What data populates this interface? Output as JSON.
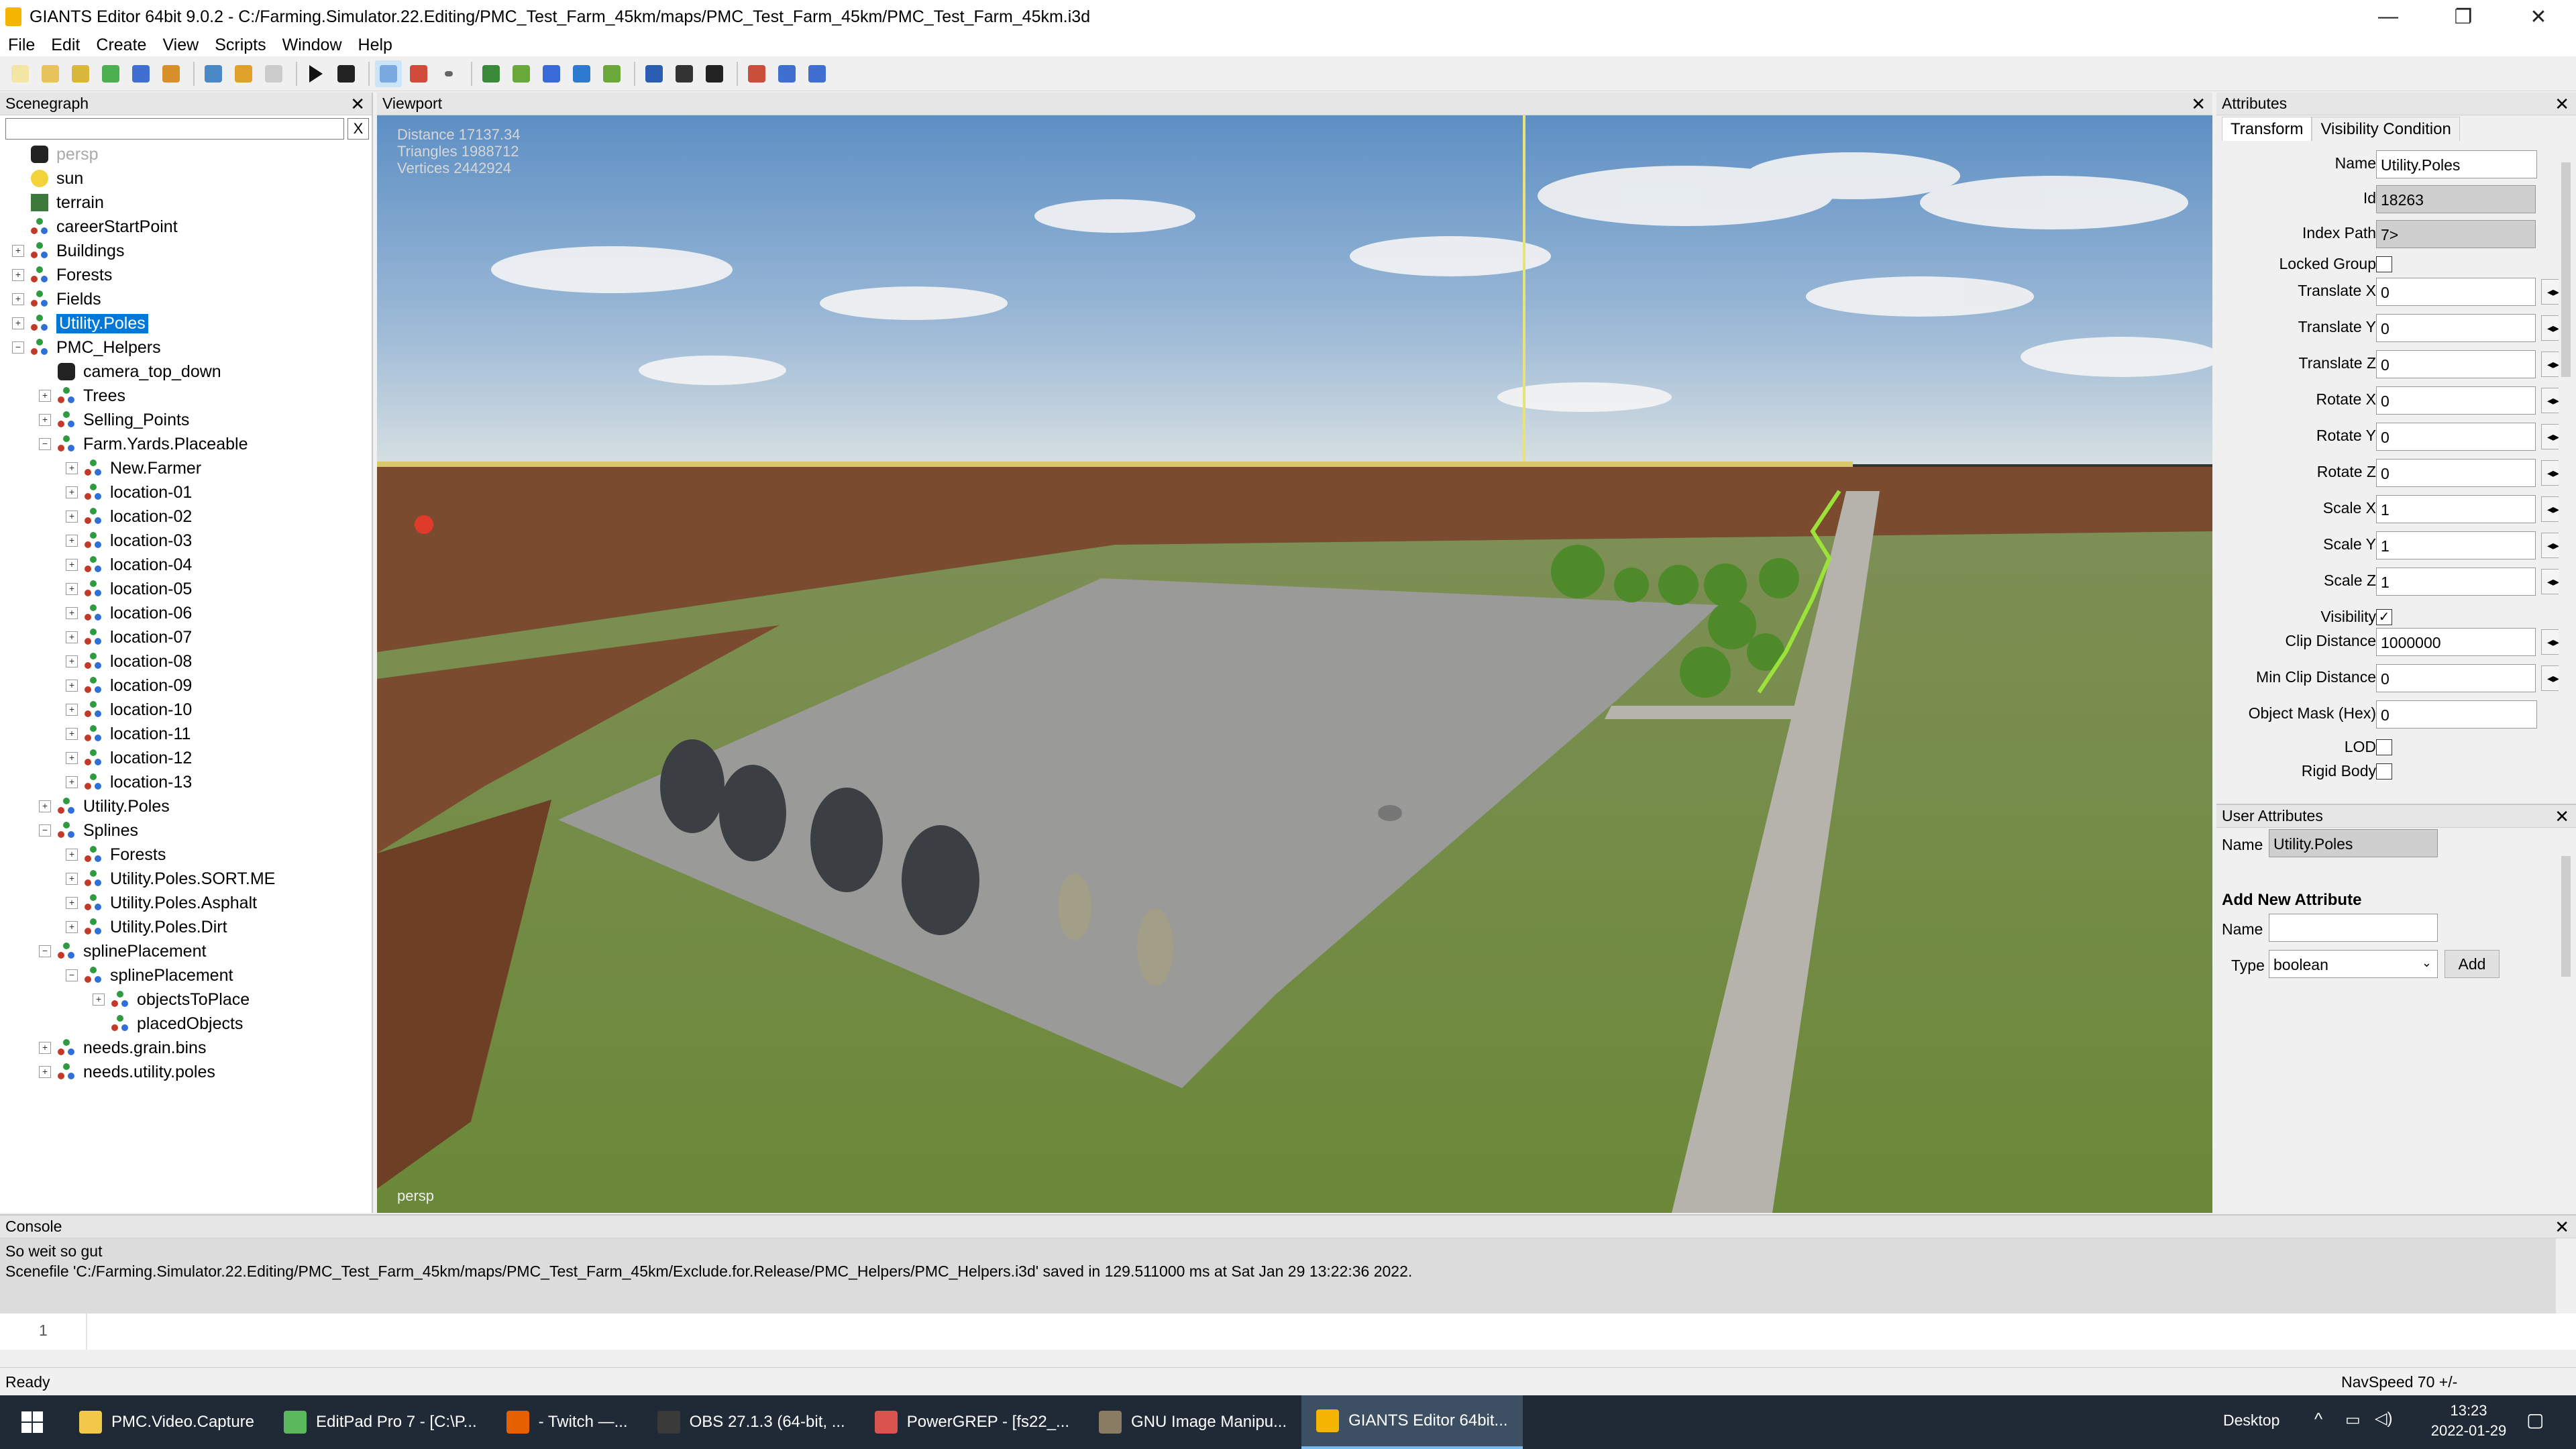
{
  "window": {
    "title": "GIANTS Editor 64bit 9.0.2 - C:/Farming.Simulator.22.Editing/PMC_Test_Farm_45km/maps/PMC_Test_Farm_45km/PMC_Test_Farm_45km.i3d",
    "minimize": "—",
    "maximize": "❐",
    "close": "✕"
  },
  "menu": [
    "File",
    "Edit",
    "Create",
    "View",
    "Scripts",
    "Window",
    "Help"
  ],
  "toolbar_icons": [
    "new-file-icon",
    "open-file-icon",
    "edit-icon",
    "refresh-icon",
    "save-icon",
    "export-icon",
    "history-icon",
    "undo-icon",
    "redo-icon",
    "play-icon",
    "eye-icon",
    "select-icon",
    "paint-icon",
    "dropdown-icon",
    "terrain-icon",
    "foliage-icon",
    "brush-icon",
    "decal-icon",
    "tree-icon",
    "move-icon",
    "rotate-icon",
    "scale-icon",
    "render-icon",
    "settings-icon",
    "tools-icon"
  ],
  "scenegraph": {
    "title": "Scenegraph",
    "close": "✕",
    "search_clear": "X",
    "nodes": [
      {
        "label": "persp",
        "depth": 0,
        "exp": "",
        "icon": "camera",
        "dim": true
      },
      {
        "label": "sun",
        "depth": 0,
        "exp": "",
        "icon": "light"
      },
      {
        "label": "terrain",
        "depth": 0,
        "exp": "",
        "icon": "terrain"
      },
      {
        "label": "careerStartPoint",
        "depth": 0,
        "exp": "",
        "icon": "tg"
      },
      {
        "label": "Buildings",
        "depth": 0,
        "exp": "+",
        "icon": "tg"
      },
      {
        "label": "Forests",
        "depth": 0,
        "exp": "+",
        "icon": "tg"
      },
      {
        "label": "Fields",
        "depth": 0,
        "exp": "+",
        "icon": "tg"
      },
      {
        "label": "Utility.Poles",
        "depth": 0,
        "exp": "+",
        "icon": "tg",
        "selected": true
      },
      {
        "label": "PMC_Helpers",
        "depth": 0,
        "exp": "−",
        "icon": "tg"
      },
      {
        "label": "camera_top_down",
        "depth": 1,
        "exp": "",
        "icon": "camera"
      },
      {
        "label": "Trees",
        "depth": 1,
        "exp": "+",
        "icon": "tg"
      },
      {
        "label": "Selling_Points",
        "depth": 1,
        "exp": "+",
        "icon": "tg"
      },
      {
        "label": "Farm.Yards.Placeable",
        "depth": 1,
        "exp": "−",
        "icon": "tg"
      },
      {
        "label": "New.Farmer",
        "depth": 2,
        "exp": "+",
        "icon": "tg"
      },
      {
        "label": "location-01",
        "depth": 2,
        "exp": "+",
        "icon": "tg"
      },
      {
        "label": "location-02",
        "depth": 2,
        "exp": "+",
        "icon": "tg"
      },
      {
        "label": "location-03",
        "depth": 2,
        "exp": "+",
        "icon": "tg"
      },
      {
        "label": "location-04",
        "depth": 2,
        "exp": "+",
        "icon": "tg"
      },
      {
        "label": "location-05",
        "depth": 2,
        "exp": "+",
        "icon": "tg"
      },
      {
        "label": "location-06",
        "depth": 2,
        "exp": "+",
        "icon": "tg"
      },
      {
        "label": "location-07",
        "depth": 2,
        "exp": "+",
        "icon": "tg"
      },
      {
        "label": "location-08",
        "depth": 2,
        "exp": "+",
        "icon": "tg"
      },
      {
        "label": "location-09",
        "depth": 2,
        "exp": "+",
        "icon": "tg"
      },
      {
        "label": "location-10",
        "depth": 2,
        "exp": "+",
        "icon": "tg"
      },
      {
        "label": "location-11",
        "depth": 2,
        "exp": "+",
        "icon": "tg"
      },
      {
        "label": "location-12",
        "depth": 2,
        "exp": "+",
        "icon": "tg"
      },
      {
        "label": "location-13",
        "depth": 2,
        "exp": "+",
        "icon": "tg"
      },
      {
        "label": "Utility.Poles",
        "depth": 1,
        "exp": "+",
        "icon": "tg"
      },
      {
        "label": "Splines",
        "depth": 1,
        "exp": "−",
        "icon": "tg"
      },
      {
        "label": "Forests",
        "depth": 2,
        "exp": "+",
        "icon": "tg"
      },
      {
        "label": "Utility.Poles.SORT.ME",
        "depth": 2,
        "exp": "+",
        "icon": "tg"
      },
      {
        "label": "Utility.Poles.Asphalt",
        "depth": 2,
        "exp": "+",
        "icon": "tg"
      },
      {
        "label": "Utility.Poles.Dirt",
        "depth": 2,
        "exp": "+",
        "icon": "tg"
      },
      {
        "label": "splinePlacement",
        "depth": 1,
        "exp": "−",
        "icon": "tg"
      },
      {
        "label": "splinePlacement",
        "depth": 2,
        "exp": "−",
        "icon": "tg"
      },
      {
        "label": "objectsToPlace",
        "depth": 3,
        "exp": "+",
        "icon": "tg"
      },
      {
        "label": "placedObjects",
        "depth": 3,
        "exp": "",
        "icon": "tg"
      },
      {
        "label": "needs.grain.bins",
        "depth": 1,
        "exp": "+",
        "icon": "tg"
      },
      {
        "label": "needs.utility.poles",
        "depth": 1,
        "exp": "+",
        "icon": "tg"
      }
    ]
  },
  "viewport": {
    "title": "Viewport",
    "close": "✕",
    "stats": [
      "Distance 17137.34",
      "Triangles 1988712",
      "Vertices 2442924"
    ],
    "camera": "persp"
  },
  "attributes": {
    "title": "Attributes",
    "close": "✕",
    "tabs": [
      "Transform",
      "Visibility Condition"
    ],
    "fields": {
      "name": {
        "label": "Name",
        "value": "Utility.Poles"
      },
      "id": {
        "label": "Id",
        "value": "18263"
      },
      "index_path": {
        "label": "Index Path",
        "value": "7>"
      },
      "locked_group": {
        "label": "Locked Group",
        "checked": false
      },
      "translate_x": {
        "label": "Translate X",
        "value": "0"
      },
      "translate_y": {
        "label": "Translate Y",
        "value": "0"
      },
      "translate_z": {
        "label": "Translate Z",
        "value": "0"
      },
      "rotate_x": {
        "label": "Rotate X",
        "value": "0"
      },
      "rotate_y": {
        "label": "Rotate Y",
        "value": "0"
      },
      "rotate_z": {
        "label": "Rotate Z",
        "value": "0"
      },
      "scale_x": {
        "label": "Scale X",
        "value": "1"
      },
      "scale_y": {
        "label": "Scale Y",
        "value": "1"
      },
      "scale_z": {
        "label": "Scale Z",
        "value": "1"
      },
      "visibility": {
        "label": "Visibility",
        "checked": true,
        "mark": "✓"
      },
      "clip_distance": {
        "label": "Clip Distance",
        "value": "1000000"
      },
      "min_clip_distance": {
        "label": "Min Clip Distance",
        "value": "0"
      },
      "object_mask": {
        "label": "Object Mask (Hex)",
        "value": "0"
      },
      "lod": {
        "label": "LOD",
        "checked": false
      },
      "rigid_body": {
        "label": "Rigid Body",
        "checked": false
      }
    },
    "spin_glyph": "◂▸"
  },
  "user_attributes": {
    "title": "User Attributes",
    "close": "✕",
    "name_label": "Name",
    "name_value": "Utility.Poles",
    "add_heading": "Add New Attribute",
    "new_name_label": "Name",
    "new_name_value": "",
    "type_label": "Type",
    "type_value": "boolean",
    "add_button": "Add"
  },
  "console": {
    "title": "Console",
    "close": "✕",
    "lines": [
      "So weit so gut",
      "Scenefile 'C:/Farming.Simulator.22.Editing/PMC_Test_Farm_45km/maps/PMC_Test_Farm_45km/Exclude.for.Release/PMC_Helpers/PMC_Helpers.i3d' saved in 129.511000 ms at Sat Jan 29 13:22:36 2022."
    ],
    "line_number": "1"
  },
  "status": {
    "left": "Ready",
    "right": "NavSpeed 70 +/-"
  },
  "taskbar": {
    "items": [
      {
        "label": "PMC.Video.Capture",
        "color": "#f2c84b"
      },
      {
        "label": "EditPad Pro 7 - [C:\\P...",
        "color": "#5cb85c"
      },
      {
        "label": "- Twitch —...",
        "color": "#e66000"
      },
      {
        "label": "OBS 27.1.3 (64-bit, ...",
        "color": "#3a3a3a"
      },
      {
        "label": "PowerGREP - [fs22_...",
        "color": "#d9534f"
      },
      {
        "label": "GNU Image Manipu...",
        "color": "#8a7b63"
      },
      {
        "label": "GIANTS Editor 64bit...",
        "color": "#f5b400",
        "active": true
      }
    ],
    "desktop": "Desktop",
    "time": "13:23",
    "date": "2022-01-29"
  },
  "colors": {
    "selection": "#0078d7",
    "taskbar": "#1f2a36",
    "sky_top": "#5d8fc4",
    "field_brown": "#7a4b2e",
    "grass": "#6e8a3e"
  }
}
